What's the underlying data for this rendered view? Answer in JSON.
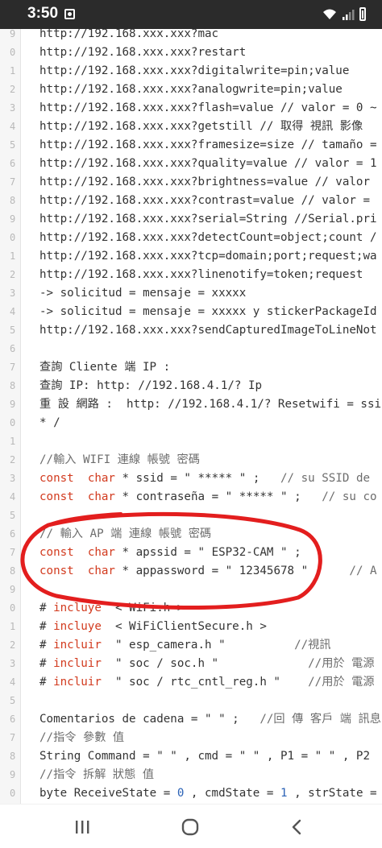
{
  "status_bar": {
    "time": "3:50",
    "icons": [
      "app-notification-icon",
      "wifi-icon",
      "signal-icon",
      "battery-icon"
    ]
  },
  "code_lines": [
    {
      "ln": "9",
      "tokens": [
        {
          "t": "http://192.168.xxx.xxx?mac",
          "c": ""
        }
      ]
    },
    {
      "ln": "0",
      "tokens": [
        {
          "t": "http://192.168.xxx.xxx?restart",
          "c": ""
        }
      ]
    },
    {
      "ln": "1",
      "tokens": [
        {
          "t": "http://192.168.xxx.xxx?digitalwrite=pin;value",
          "c": ""
        }
      ]
    },
    {
      "ln": "2",
      "tokens": [
        {
          "t": "http://192.168.xxx.xxx?analogwrite=pin;value",
          "c": ""
        }
      ]
    },
    {
      "ln": "3",
      "tokens": [
        {
          "t": "http://192.168.xxx.xxx?flash=value // valor = 0 ~",
          "c": ""
        }
      ]
    },
    {
      "ln": "4",
      "tokens": [
        {
          "t": "http://192.168.xxx.xxx?getstill // 取得 視訊 影像",
          "c": ""
        }
      ]
    },
    {
      "ln": "5",
      "tokens": [
        {
          "t": "http://192.168.xxx.xxx?framesize=size // tamaño =",
          "c": ""
        }
      ]
    },
    {
      "ln": "6",
      "tokens": [
        {
          "t": "http://192.168.xxx.xxx?quality=value // valor = 1",
          "c": ""
        }
      ]
    },
    {
      "ln": "7",
      "tokens": [
        {
          "t": "http://192.168.xxx.xxx?brightness=value // valor",
          "c": ""
        }
      ]
    },
    {
      "ln": "8",
      "tokens": [
        {
          "t": "http://192.168.xxx.xxx?contrast=value // valor =",
          "c": ""
        }
      ]
    },
    {
      "ln": "9",
      "tokens": [
        {
          "t": "http://192.168.xxx.xxx?serial=String //Serial.pri",
          "c": ""
        }
      ]
    },
    {
      "ln": "0",
      "tokens": [
        {
          "t": "http://192.168.xxx.xxx?detectCount=object;count /",
          "c": ""
        }
      ]
    },
    {
      "ln": "1",
      "tokens": [
        {
          "t": "http://192.168.xxx.xxx?tcp=domain;port;request;wa",
          "c": ""
        }
      ]
    },
    {
      "ln": "2",
      "tokens": [
        {
          "t": "http://192.168.xxx.xxx?linenotify=token;request",
          "c": ""
        }
      ]
    },
    {
      "ln": "3",
      "tokens": [
        {
          "t": "-> solicitud = mensaje = xxxxx",
          "c": ""
        }
      ]
    },
    {
      "ln": "4",
      "tokens": [
        {
          "t": "-> solicitud = mensaje = xxxxx y stickerPackageId",
          "c": ""
        }
      ]
    },
    {
      "ln": "5",
      "tokens": [
        {
          "t": "http://192.168.xxx.xxx?sendCapturedImageToLineNot",
          "c": ""
        }
      ]
    },
    {
      "ln": "6",
      "tokens": []
    },
    {
      "ln": "7",
      "tokens": [
        {
          "t": "查詢 Cliente 端 IP :",
          "c": ""
        }
      ]
    },
    {
      "ln": "8",
      "tokens": [
        {
          "t": "查詢 IP: http: //192.168.4.1/? Ip",
          "c": ""
        }
      ]
    },
    {
      "ln": "9",
      "tokens": [
        {
          "t": "重 設 網路 :  http: //192.168.4.1/? Resetwifi = ssi",
          "c": ""
        }
      ]
    },
    {
      "ln": "0",
      "tokens": [
        {
          "t": "* /",
          "c": ""
        }
      ]
    },
    {
      "ln": "1",
      "tokens": []
    },
    {
      "ln": "2",
      "tokens": [
        {
          "t": "//輸入 WIFI 連線 帳號 密碼",
          "c": "cm"
        }
      ]
    },
    {
      "ln": "3",
      "tokens": [
        {
          "t": "const",
          "c": "kw"
        },
        {
          "t": "  ",
          "c": ""
        },
        {
          "t": "char",
          "c": "kw"
        },
        {
          "t": " * ssid = \" ***** \" ;   ",
          "c": ""
        },
        {
          "t": "// su SSID de",
          "c": "cm"
        }
      ]
    },
    {
      "ln": "4",
      "tokens": [
        {
          "t": "const",
          "c": "kw"
        },
        {
          "t": "  ",
          "c": ""
        },
        {
          "t": "char",
          "c": "kw"
        },
        {
          "t": " * contraseña = \" ***** \" ;   ",
          "c": ""
        },
        {
          "t": "// su co",
          "c": "cm"
        }
      ]
    },
    {
      "ln": "5",
      "tokens": []
    },
    {
      "ln": "6",
      "tokens": [
        {
          "t": "// 輸入 AP 端 連線 帳號 密碼",
          "c": "cm"
        }
      ]
    },
    {
      "ln": "7",
      "tokens": [
        {
          "t": "const",
          "c": "kw"
        },
        {
          "t": "  ",
          "c": ""
        },
        {
          "t": "char",
          "c": "kw"
        },
        {
          "t": " * apssid = \" ESP32-CAM \" ;",
          "c": ""
        }
      ]
    },
    {
      "ln": "8",
      "tokens": [
        {
          "t": "const",
          "c": "kw"
        },
        {
          "t": "  ",
          "c": ""
        },
        {
          "t": "char",
          "c": "kw"
        },
        {
          "t": " * appassword = \" 12345678 \" ;    ",
          "c": ""
        },
        {
          "t": "// A",
          "c": "cm"
        }
      ]
    },
    {
      "ln": "9",
      "tokens": []
    },
    {
      "ln": "0",
      "tokens": [
        {
          "t": "# ",
          "c": ""
        },
        {
          "t": "incluye",
          "c": "kw"
        },
        {
          "t": "  < WiFi.h >",
          "c": ""
        }
      ]
    },
    {
      "ln": "1",
      "tokens": [
        {
          "t": "# ",
          "c": ""
        },
        {
          "t": "incluye",
          "c": "kw"
        },
        {
          "t": "  < WiFiClientSecure.h >",
          "c": ""
        }
      ]
    },
    {
      "ln": "2",
      "tokens": [
        {
          "t": "# ",
          "c": ""
        },
        {
          "t": "incluir",
          "c": "kw"
        },
        {
          "t": "  \" esp_camera.h \"          ",
          "c": ""
        },
        {
          "t": "//視訊",
          "c": "cm"
        }
      ]
    },
    {
      "ln": "3",
      "tokens": [
        {
          "t": "# ",
          "c": ""
        },
        {
          "t": "incluir",
          "c": "kw"
        },
        {
          "t": "  \" soc / soc.h \"             ",
          "c": ""
        },
        {
          "t": "//用於 電源",
          "c": "cm"
        }
      ]
    },
    {
      "ln": "4",
      "tokens": [
        {
          "t": "# ",
          "c": ""
        },
        {
          "t": "incluir",
          "c": "kw"
        },
        {
          "t": "  \" soc / rtc_cntl_reg.h \"    ",
          "c": ""
        },
        {
          "t": "//用於 電源",
          "c": "cm"
        }
      ]
    },
    {
      "ln": "5",
      "tokens": []
    },
    {
      "ln": "6",
      "tokens": [
        {
          "t": "Comentarios de cadena = \" \" ;   ",
          "c": ""
        },
        {
          "t": "//回 傳 客戶 端 訊息",
          "c": "cm"
        }
      ]
    },
    {
      "ln": "7",
      "tokens": [
        {
          "t": "//指令 參數 值",
          "c": "cm"
        }
      ]
    },
    {
      "ln": "8",
      "tokens": [
        {
          "t": "String Command = \" \" , cmd = \" \" , P1 = \" \" , P2",
          "c": ""
        }
      ]
    },
    {
      "ln": "9",
      "tokens": [
        {
          "t": "//指令 拆解 狀態 值",
          "c": "cm"
        }
      ]
    },
    {
      "ln": "0",
      "tokens": [
        {
          "t": "byte ReceiveState = ",
          "c": ""
        },
        {
          "t": "0",
          "c": "num"
        },
        {
          "t": " , cmdState = ",
          "c": ""
        },
        {
          "t": "1",
          "c": "num"
        },
        {
          "t": " , strState =",
          "c": ""
        }
      ]
    }
  ],
  "colors": {
    "keyword": "#d23a1e",
    "comment": "#6d6d6d",
    "number": "#2b62b6",
    "annotation_circle": "#e31e1e"
  },
  "nav_bar": {
    "buttons": [
      "recent-apps-icon",
      "home-icon",
      "back-icon"
    ]
  }
}
